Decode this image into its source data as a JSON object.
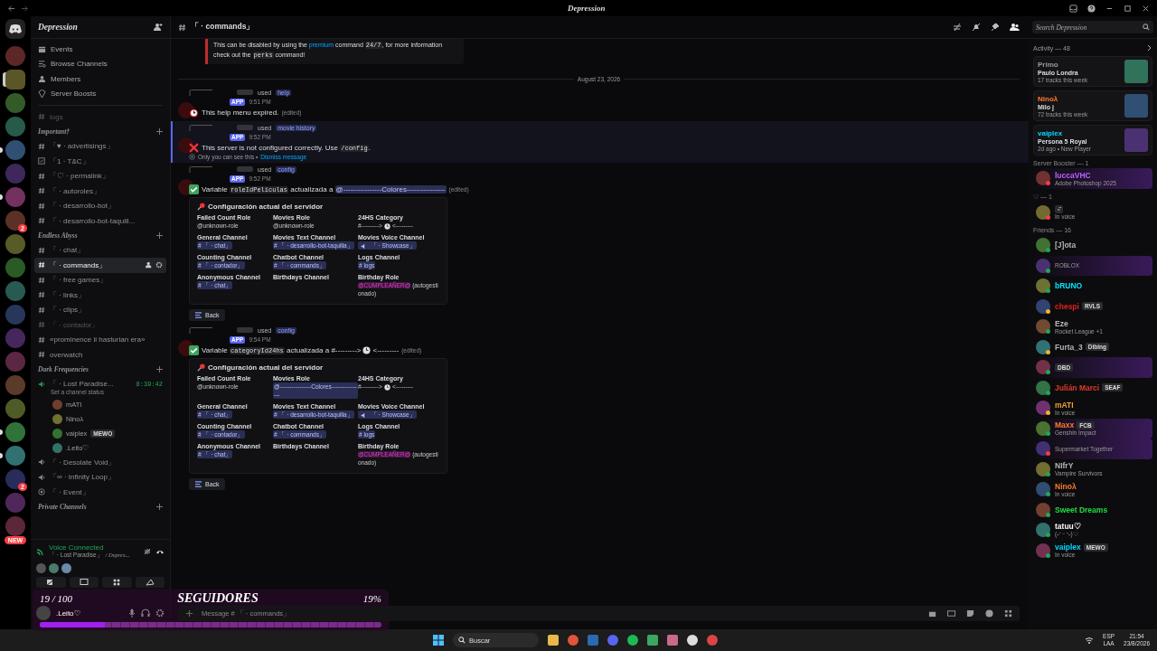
{
  "window": {
    "title": "Depression"
  },
  "server_rail": {
    "items": [
      {
        "selected": false,
        "unread": false
      },
      {
        "selected": true,
        "unread": false
      },
      {
        "selected": false,
        "unread": false
      },
      {
        "selected": false,
        "unread": false
      },
      {
        "selected": false,
        "unread": true
      },
      {
        "selected": false,
        "unread": false
      },
      {
        "selected": false,
        "unread": true
      },
      {
        "selected": false,
        "unread": false,
        "badge": "2"
      },
      {
        "selected": false,
        "unread": false
      },
      {
        "selected": false,
        "unread": false
      },
      {
        "selected": false,
        "unread": false
      },
      {
        "selected": false,
        "unread": false
      },
      {
        "selected": false,
        "unread": false
      },
      {
        "selected": false,
        "unread": false
      },
      {
        "selected": false,
        "unread": false
      },
      {
        "selected": false,
        "unread": false
      },
      {
        "selected": false,
        "unread": true
      },
      {
        "selected": false,
        "unread": true
      },
      {
        "selected": false,
        "unread": false,
        "badge": "2"
      },
      {
        "selected": false,
        "unread": false
      },
      {
        "selected": false,
        "unread": false,
        "badge": "NEW"
      }
    ]
  },
  "sidebar": {
    "server_name": "Depression",
    "shortcuts": [
      {
        "label": "Events",
        "kind": "events"
      },
      {
        "label": "Browse Channels",
        "kind": "browse"
      },
      {
        "label": "Members",
        "kind": "members"
      },
      {
        "label": "Server Boosts",
        "kind": "boosts"
      }
    ],
    "channels": [
      {
        "name": "logs",
        "kind": "text",
        "muted": true,
        "selected": false
      }
    ],
    "categories": [
      {
        "name": "Important†",
        "channels": [
          {
            "name": "「♥ · advertisings」",
            "kind": "text",
            "muted": false,
            "selected": false
          },
          {
            "name": "「1 · T&C」",
            "kind": "rules",
            "muted": false,
            "selected": false
          },
          {
            "name": "「♡ · permalink」",
            "kind": "text",
            "muted": false,
            "selected": false
          },
          {
            "name": "「 · autoroles」",
            "kind": "text",
            "muted": false,
            "selected": false
          },
          {
            "name": "「 · desarrollo-bot」",
            "kind": "text",
            "muted": false,
            "selected": false
          },
          {
            "name": "「 · desarrollo-bot-taquill...",
            "kind": "text",
            "muted": false,
            "selected": false
          }
        ]
      },
      {
        "name": "Endless Abyss",
        "channels": [
          {
            "name": "「 · chat」",
            "kind": "text",
            "muted": false,
            "selected": false
          },
          {
            "name": "「 · commands」",
            "kind": "text",
            "muted": false,
            "selected": true
          },
          {
            "name": "「 · free games」",
            "kind": "text",
            "muted": false,
            "selected": false
          },
          {
            "name": "「 · links」",
            "kind": "text",
            "muted": false,
            "selected": false
          },
          {
            "name": "「 · clips」",
            "kind": "text",
            "muted": false,
            "selected": false
          },
          {
            "name": "「 · contador」",
            "kind": "text",
            "muted": true,
            "selected": false
          },
          {
            "name": "«prominence ii hasturian era»",
            "kind": "text",
            "muted": false,
            "selected": false
          },
          {
            "name": "overwatch",
            "kind": "text",
            "muted": false,
            "selected": false
          }
        ]
      },
      {
        "name": "Dark Frequencies",
        "channels": [
          {
            "name": "「 · Lost Paradise...",
            "kind": "voice",
            "muted": false,
            "selected": false,
            "timer": "8:39:42",
            "status": "Set a channel status",
            "users": [
              {
                "name": "mATI"
              },
              {
                "name": "Ninoλ"
              },
              {
                "name": "vaiplex",
                "tag": "MEWO"
              },
              {
                "name": ".Leito♡"
              }
            ]
          },
          {
            "name": "「 · Desolate Void」",
            "kind": "voice",
            "muted": false,
            "selected": false
          },
          {
            "name": "「∞ · Infinity Loop」",
            "kind": "voice",
            "muted": false,
            "selected": false
          },
          {
            "name": "「 · Event」",
            "kind": "stage",
            "muted": false,
            "selected": false
          }
        ]
      },
      {
        "name": "Private Channels"
      }
    ]
  },
  "voice_panel": {
    "status": "Voice Connected",
    "channel": "「 · Lost Paradise」",
    "server": "/ Depres..."
  },
  "user_panel": {
    "name": ".Leito♡"
  },
  "header": {
    "channel": "「 · commands」",
    "search": {
      "placeholder": "Search Depression"
    }
  },
  "messages": [
    {
      "kind": "fragment",
      "content": [
        {
          "kind": "text",
          "text": "This can be disabled by using the "
        },
        {
          "kind": "link",
          "text": "premium"
        },
        {
          "kind": "text",
          "text": " command "
        },
        {
          "kind": "code",
          "text": "24/7"
        },
        {
          "kind": "text",
          "text": ", for more information check out the "
        },
        {
          "kind": "code",
          "text": "perks"
        },
        {
          "kind": "text",
          "text": " command!"
        }
      ]
    },
    {
      "kind": "divider",
      "text": "August 23, 2026"
    },
    {
      "kind": "expired",
      "highlighted": false,
      "used": "used",
      "command": "help",
      "app": "APP",
      "time": "9:51 PM",
      "edited": "(edited)",
      "content": [
        {
          "kind": "text",
          "text": "This help menu expired."
        }
      ]
    },
    {
      "kind": "error",
      "highlighted": true,
      "used": "used",
      "command": "movie history",
      "app": "APP",
      "time": "9:52 PM",
      "content": [
        {
          "kind": "text",
          "text": "This server is not configured correctly. Use "
        },
        {
          "kind": "code",
          "text": "/config"
        },
        {
          "kind": "text",
          "text": "."
        }
      ],
      "ephemeral": {
        "text": "Only you can see this •",
        "link": "Dismiss message"
      }
    },
    {
      "kind": "success",
      "highlighted": false,
      "used": "used",
      "command": "config",
      "app": "APP",
      "time": "9:52 PM",
      "edited": "(edited)",
      "content": [
        {
          "kind": "text",
          "text": "Variable "
        },
        {
          "kind": "code",
          "text": "roleIdPeliculas"
        },
        {
          "kind": "text",
          "text": " actualizada a "
        },
        {
          "kind": "mention",
          "text": "@----------------Colores----------------"
        }
      ],
      "embed": {
        "title": "Configuración actual del servidor",
        "fields": [
          {
            "name": "Failed Count Role",
            "value": [
              {
                "kind": "text",
                "text": "@unknown-role"
              }
            ]
          },
          {
            "name": "Movies Role",
            "value": [
              {
                "kind": "text",
                "text": "@unknown-role"
              }
            ]
          },
          {
            "name": "24HS Category",
            "value": [
              {
                "kind": "text",
                "text": "#--------->"
              },
              {
                "kind": "clock"
              },
              {
                "kind": "text",
                "text": "<---------"
              }
            ]
          },
          {
            "name": "General Channel",
            "value": [
              {
                "kind": "mention",
                "text": "# 「 · chat」"
              }
            ]
          },
          {
            "name": "Movies Text Channel",
            "value": [
              {
                "kind": "mention",
                "text": "# 「 · desarrollo-bot-taquilla」"
              }
            ]
          },
          {
            "name": "Movies Voice Channel",
            "value": [
              {
                "kind": "voice_mention",
                "text": "「 · Showcase」"
              }
            ]
          },
          {
            "name": "Counting Channel",
            "value": [
              {
                "kind": "mention",
                "text": "# 「 · contador」"
              }
            ]
          },
          {
            "name": "Chatbot Channel",
            "value": [
              {
                "kind": "mention",
                "text": "# 「 · commands」"
              }
            ]
          },
          {
            "name": "Logs Channel",
            "value": [
              {
                "kind": "mention",
                "text": "# logs"
              }
            ]
          },
          {
            "name": "Anonymous Channel",
            "value": [
              {
                "kind": "mention",
                "text": "# 「 · chat」"
              }
            ]
          },
          {
            "name": "Birthdays Channel"
          },
          {
            "name": "Birthday Role",
            "value": [
              {
                "kind": "role",
                "text": "@CUMPLEAÑER@"
              },
              {
                "kind": "text",
                "text": " (autogestionado)"
              }
            ]
          }
        ]
      },
      "button": "Back"
    },
    {
      "kind": "success",
      "highlighted": false,
      "used": "used",
      "command": "config",
      "app": "APP",
      "time": "9:54 PM",
      "edited": "(edited)",
      "content": [
        {
          "kind": "text",
          "text": "Variable "
        },
        {
          "kind": "code",
          "text": "categoryId24hs"
        },
        {
          "kind": "text",
          "text": " actualizada a #--------->"
        },
        {
          "kind": "clock"
        },
        {
          "kind": "text",
          "text": "<---------"
        }
      ],
      "embed": {
        "title": "Configuración actual del servidor",
        "fields": [
          {
            "name": "Failed Count Role",
            "value": [
              {
                "kind": "text",
                "text": "@unknown-role"
              }
            ]
          },
          {
            "name": "Movies Role",
            "value": [
              {
                "kind": "mention",
                "text": "@----------------Colores----------------"
              }
            ]
          },
          {
            "name": "24HS Category",
            "value": [
              {
                "kind": "text",
                "text": "#--------->"
              },
              {
                "kind": "clock"
              },
              {
                "kind": "text",
                "text": "<---------"
              }
            ]
          },
          {
            "name": "General Channel",
            "value": [
              {
                "kind": "mention",
                "text": "# 「 · chat」"
              }
            ]
          },
          {
            "name": "Movies Text Channel",
            "value": [
              {
                "kind": "mention",
                "text": "# 「 · desarrollo-bot-taquilla」"
              }
            ]
          },
          {
            "name": "Movies Voice Channel",
            "value": [
              {
                "kind": "voice_mention",
                "text": "「 · Showcase」"
              }
            ]
          },
          {
            "name": "Counting Channel",
            "value": [
              {
                "kind": "mention",
                "text": "# 「 · contador」"
              }
            ]
          },
          {
            "name": "Chatbot Channel",
            "value": [
              {
                "kind": "mention",
                "text": "# 「 · commands」"
              }
            ]
          },
          {
            "name": "Logs Channel",
            "value": [
              {
                "kind": "mention",
                "text": "# logs"
              }
            ]
          },
          {
            "name": "Anonymous Channel",
            "value": [
              {
                "kind": "mention",
                "text": "# 「 · chat」"
              }
            ]
          },
          {
            "name": "Birthdays Channel"
          },
          {
            "name": "Birthday Role",
            "value": [
              {
                "kind": "role",
                "text": "@CUMPLEAÑER@"
              },
              {
                "kind": "text",
                "text": " (autogestionado)"
              }
            ]
          }
        ]
      },
      "button": "Back"
    }
  ],
  "message_box": {
    "placeholder": "Message # 「 · commands」"
  },
  "members": {
    "activity": {
      "title": "Activity — 48",
      "cards": [
        {
          "user": "Primo",
          "color": "#9a9a9a",
          "title": "Paulo Londra",
          "detail": "17 tracks this week"
        },
        {
          "user": "Ninoλ",
          "color": "#ff7a30",
          "title": "Milo j",
          "detail": "72 tracks this week"
        },
        {
          "user": "vaiplex",
          "color": "#00d8ff",
          "title": "Persona 5 Royal",
          "detail": "2d ago • New Player"
        }
      ]
    },
    "sections": [
      {
        "title": "Server Booster — 1",
        "rows": [
          {
            "name": "luccaVHC",
            "color": "#c060ff",
            "kind": "dnd",
            "activity": "Adobe Photoshop 2025",
            "banner": true
          }
        ]
      },
      {
        "title": "♡ — 1",
        "rows": [
          {
            "kind": "dnd",
            "activity": "In voice",
            "tag": "ᵕ̈",
            "banner": false
          }
        ]
      },
      {
        "title": "Friends — 16",
        "rows": [
          {
            "name": "[J]ota",
            "color": "#b5b5b5",
            "kind": "online",
            "banner": false
          },
          {
            "kind": "online",
            "activity": "ROBLOX",
            "banner": true
          },
          {
            "name": "bRUNO",
            "color": "#00e5ff",
            "kind": "online",
            "banner": false
          },
          {
            "name": "chespi",
            "color": "#e0201e",
            "kind": "idle",
            "tag": "RVLS",
            "banner": false
          },
          {
            "name": "Eze",
            "color": "#b5b5b5",
            "kind": "online",
            "activity": "Rocket League +1",
            "banner": false
          },
          {
            "name": "Furta_3",
            "color": "#b5b5b5",
            "kind": "idle",
            "tag": "Dibing",
            "banner": false
          },
          {
            "kind": "online",
            "tag": "DBD",
            "banner": true
          },
          {
            "name": "Julián Marci",
            "color": "#e03a2a",
            "kind": "online",
            "tag": "SEAF",
            "banner": false
          },
          {
            "name": "mATI",
            "color": "#f0a030",
            "kind": "idle",
            "activity": "In voice",
            "banner": false
          },
          {
            "name": "Maxx",
            "color": "#ff7a30",
            "kind": "online",
            "tag": "FCB",
            "activity": "Genshin Impact",
            "banner": true
          },
          {
            "kind": "dnd",
            "activity": "Supermarket Together",
            "banner": true
          },
          {
            "name": "NIfrY",
            "color": "#b5b5b5",
            "kind": "online",
            "activity": "Vampire Survivors",
            "banner": false
          },
          {
            "name": "Ninoλ",
            "color": "#ff7a30",
            "kind": "online",
            "activity": "In voice",
            "banner": false
          },
          {
            "name": "Sweet Dreams",
            "color": "#22dd44",
            "kind": "online",
            "banner": false
          },
          {
            "name": "tatuu♡",
            "color": "#ffffff",
            "kind": "online",
            "activity": "(˶ᵔ ᵕ ᵔ˶)♡",
            "banner": false
          },
          {
            "name": "vaiplex",
            "color": "#00d8ff",
            "kind": "online",
            "tag": "MEWO",
            "activity": "In voice",
            "banner": false
          }
        ]
      }
    ]
  },
  "overlay": {
    "title": "SEGUIDORES",
    "count": "19 / 100",
    "percent": "19%",
    "level": 0.19
  },
  "taskbar": {
    "search": {
      "placeholder": "Buscar"
    },
    "language": [
      "ESP",
      "LAA"
    ],
    "time": "21:54",
    "date": "23/8/2026"
  }
}
